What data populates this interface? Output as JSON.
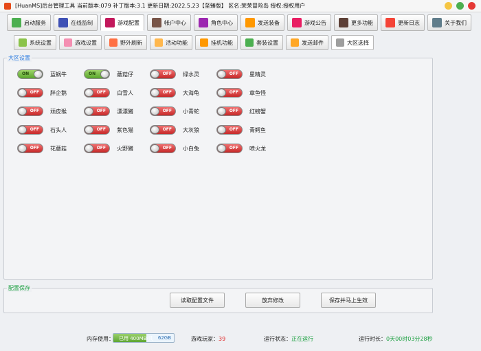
{
  "window": {
    "title": "[HuanMS]后台管理工具 当前版本:079 补丁版本:3.1 更新日期:2022.5.23【至臻版】 区名:荣荣冒险岛 授权:授权用户"
  },
  "toolbar": [
    {
      "label": "启动服务",
      "color": "#4caf50"
    },
    {
      "label": "在线监制",
      "color": "#3f51b5"
    },
    {
      "label": "游戏配置",
      "color": "#c2185b"
    },
    {
      "label": "帐户中心",
      "color": "#795548"
    },
    {
      "label": "角色中心",
      "color": "#9c27b0"
    },
    {
      "label": "发送装备",
      "color": "#ff9800"
    },
    {
      "label": "游戏公告",
      "color": "#e91e63"
    },
    {
      "label": "更多功能",
      "color": "#5d4037"
    },
    {
      "label": "更新日志",
      "color": "#f44336"
    },
    {
      "label": "关于我们",
      "color": "#607d8b"
    }
  ],
  "subtabs": [
    {
      "label": "系统设置",
      "color": "#8bc34a"
    },
    {
      "label": "游戏设置",
      "color": "#f48fb1"
    },
    {
      "label": "野外刷新",
      "color": "#ff7043"
    },
    {
      "label": "活动功能",
      "color": "#ffb74d"
    },
    {
      "label": "挂机功能",
      "color": "#ff9800"
    },
    {
      "label": "套装设置",
      "color": "#4caf50"
    },
    {
      "label": "发送邮件",
      "color": "#ffa726"
    },
    {
      "label": "大区选择",
      "color": "#9e9e9e"
    }
  ],
  "region_group": {
    "title": "大区设置",
    "on_text": "ON",
    "off_text": "OFF",
    "items": [
      {
        "name": "蓝蜗牛",
        "on": true
      },
      {
        "name": "蘑菇仔",
        "on": true
      },
      {
        "name": "绿水灵",
        "on": false
      },
      {
        "name": "星精灵",
        "on": false
      },
      {
        "name": "胖企鹅",
        "on": false
      },
      {
        "name": "白雪人",
        "on": false
      },
      {
        "name": "大海龟",
        "on": false
      },
      {
        "name": "章鱼怪",
        "on": false
      },
      {
        "name": "顽皮猴",
        "on": false
      },
      {
        "name": "漂漂猪",
        "on": false
      },
      {
        "name": "小青蛇",
        "on": false
      },
      {
        "name": "红螃蟹",
        "on": false
      },
      {
        "name": "石头人",
        "on": false
      },
      {
        "name": "紫色猫",
        "on": false
      },
      {
        "name": "大灰狼",
        "on": false
      },
      {
        "name": "青鳄鱼",
        "on": false
      },
      {
        "name": "花蘑菇",
        "on": false
      },
      {
        "name": "火野猪",
        "on": false
      },
      {
        "name": "小白兔",
        "on": false
      },
      {
        "name": "喷火龙",
        "on": false
      }
    ]
  },
  "config_group": {
    "title": "配置保存",
    "buttons": [
      "读取配置文件",
      "放弃修改",
      "保存并马上生效"
    ]
  },
  "status": {
    "memory_label": "内存使用：",
    "memory_used": "已用 400MB/共",
    "memory_total": "62GB",
    "memory_fraction": 0.55,
    "players_label": "游戏玩家：",
    "players_value": "39",
    "run_state_label": "运行状态：",
    "run_state_value": "正在运行",
    "run_time_label": "运行时长：",
    "run_time_value": "0天00时03分28秒"
  },
  "colors": {
    "win_min": "#f5c542",
    "win_max": "#4caf50",
    "win_close": "#e53935"
  }
}
